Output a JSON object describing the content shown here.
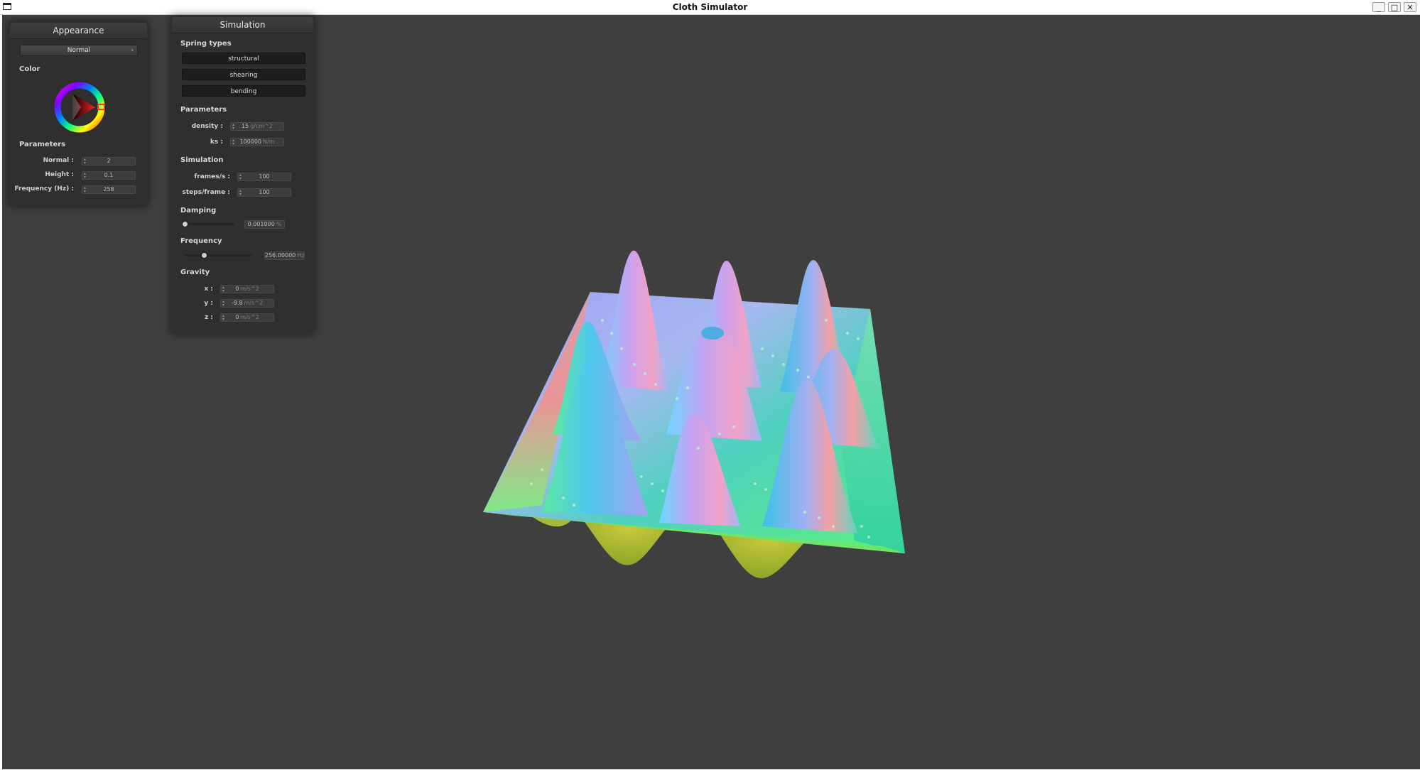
{
  "window": {
    "title": "Cloth Simulator",
    "minimize": "_",
    "maximize": "□",
    "close": "✕"
  },
  "appearance": {
    "title": "Appearance",
    "shader": "Normal",
    "color_label": "Color",
    "params_label": "Parameters",
    "normal_label": "Normal :",
    "normal_value": "2",
    "height_label": "Height :",
    "height_value": "0.1",
    "freq_label": "Frequency (Hz) :",
    "freq_value": "258"
  },
  "simulation": {
    "title": "Simulation",
    "spring_types_label": "Spring types",
    "structural": "structural",
    "shearing": "shearing",
    "bending": "bending",
    "params_label": "Parameters",
    "density_label": "density :",
    "density_value": "15",
    "density_unit": "g/cm^2",
    "ks_label": "ks :",
    "ks_value": "100000",
    "ks_unit": "N/m",
    "sim_label": "Simulation",
    "fps_label": "frames/s :",
    "fps_value": "100",
    "spf_label": "steps/frame :",
    "spf_value": "100",
    "damping_label": "Damping",
    "damping_value": "0.001000",
    "damping_unit": "%",
    "damping_level": 0.0,
    "frequency_label": "Frequency",
    "frequency_value": "256.00000",
    "frequency_unit": "Hz",
    "frequency_level": 0.28,
    "gravity_label": "Gravity",
    "gx_label": "x :",
    "gx_value": "0",
    "gy_label": "y :",
    "gy_value": "-9.8",
    "gz_label": "z :",
    "gz_value": "0",
    "gravity_unit": "m/s^2"
  },
  "colors": {
    "background": "#3f3f3f",
    "panel": "#2f2f2f",
    "color_wheel_selected": "#e02020"
  }
}
